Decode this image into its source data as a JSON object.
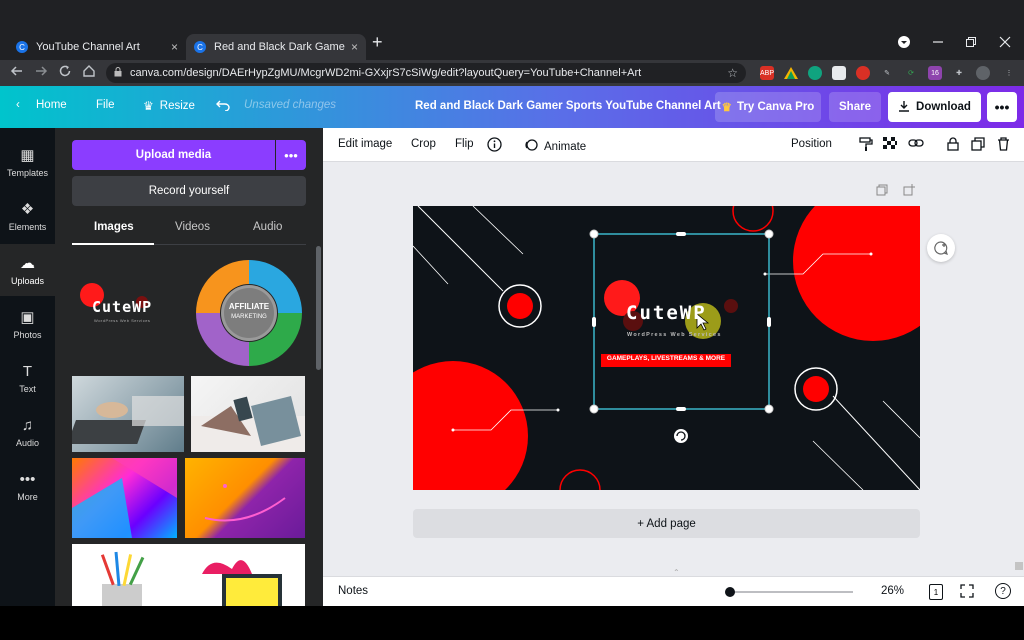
{
  "browser": {
    "tabs": [
      {
        "title": "YouTube Channel Art",
        "favicon": "C"
      },
      {
        "title": "Red and Black Dark Gamer Sports YouTube Channel Art",
        "favicon": "C"
      }
    ],
    "close_glyph": "×",
    "new_tab_glyph": "+",
    "url": "canva.com/design/DAErHypZgMU/McgrWD2mi-GXxjrS7cSiWg/edit?layoutQuery=YouTube+Channel+Art",
    "extensions": [
      "ABP",
      "",
      "",
      "",
      "",
      "",
      "",
      "",
      "16",
      ""
    ]
  },
  "topbar": {
    "home": "Home",
    "file": "File",
    "resize": "Resize",
    "unsaved": "Unsaved changes",
    "doc_title": "Red and Black Dark Gamer Sports YouTube Channel Art",
    "try_pro": "Try Canva Pro",
    "share": "Share",
    "download": "Download",
    "more": "•••"
  },
  "rail": [
    {
      "label": "Templates",
      "icon": "▦"
    },
    {
      "label": "Elements",
      "icon": "❖"
    },
    {
      "label": "Uploads",
      "icon": "☁"
    },
    {
      "label": "Photos",
      "icon": "▣"
    },
    {
      "label": "Text",
      "icon": "T"
    },
    {
      "label": "Audio",
      "icon": "♫"
    },
    {
      "label": "More",
      "icon": "•••"
    }
  ],
  "panel": {
    "upload_media": "Upload media",
    "upload_more": "•••",
    "record_yourself": "Record yourself",
    "tabs": [
      "Images",
      "Videos",
      "Audio"
    ],
    "logo_thumb": {
      "title": "CuteWP",
      "subtitle": "WordPress Web Services"
    },
    "affiliate_thumb": {
      "title": "AFFILIATE",
      "subtitle": "MARKETING"
    }
  },
  "toolbar": {
    "edit_image": "Edit image",
    "crop": "Crop",
    "flip": "Flip",
    "animate": "Animate",
    "position": "Position"
  },
  "canvas": {
    "logo_title": "CuteWP",
    "logo_subtitle": "WordPress Web Services",
    "banner_text": "GAMEPLAYS, LIVESTREAMS & MORE"
  },
  "add_page": "+ Add page",
  "footer": {
    "notes": "Notes",
    "zoom": "26%",
    "page_count": "1",
    "help": "?"
  },
  "colors": {
    "canva_purple": "#8b3dff",
    "canvas_bg": "#0e1318",
    "canvas_red": "#ff0000",
    "selection": "#3ab6c9"
  }
}
